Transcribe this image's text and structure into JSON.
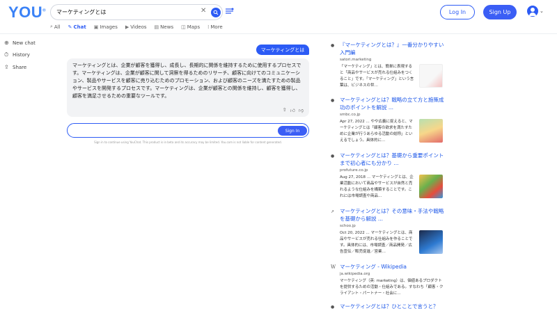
{
  "header": {
    "logo": "YOU",
    "logo_mark": "®",
    "search_query": "マーケティングとは",
    "login_label": "Log In",
    "signup_label": "Sign Up"
  },
  "tabs": [
    {
      "label": "All",
      "icon": "search-icon"
    },
    {
      "label": "Chat",
      "icon": "chat-icon",
      "active": true
    },
    {
      "label": "Images",
      "icon": "image-icon"
    },
    {
      "label": "Videos",
      "icon": "play-icon"
    },
    {
      "label": "News",
      "icon": "news-icon"
    },
    {
      "label": "Maps",
      "icon": "map-icon"
    },
    {
      "label": "More",
      "icon": "grid-icon"
    }
  ],
  "sidebar": {
    "items": [
      {
        "label": "New chat",
        "icon": "plus-icon"
      },
      {
        "label": "History",
        "icon": "history-icon"
      },
      {
        "label": "Share",
        "icon": "share-icon"
      }
    ]
  },
  "chat": {
    "user_message": "マーケティングとは",
    "answer": "マーケティングとは、企業が顧客を獲得し、成長し、長期的に関係を維持するために使用するプロセスです。マーケティングは、企業が顧客に関して洞察を得るためのリサーチ、顧客に向けてのコミュニケーション、製品やサービスを顧客に売り込むためのプロモーション、および顧客のニーズを満たすための製品やサービスを開発するプロセスです。マーケティングは、企業が顧客との関係を維持し、顧客を獲得し、顧客を満足させるための重要なツールです。",
    "input_placeholder": "",
    "signin_label": "Sign In",
    "disclaimer": "Sign in to continue using YouChat. This product is in beta and its accuracy may be limited. You.com is not liable for content generated."
  },
  "results": [
    {
      "title": "『マーケティングとは？』一番分かりやすい入門編",
      "source": "satori.marketing",
      "snippet": "「マーケティング」とは、簡単に表現すると「商品やサービスが売れる仕組みをつくること」です。「マーケティング」という言葉は、ビジネスの世…",
      "thumb": "t1",
      "bullet": "●"
    },
    {
      "title": "マーケティングとは？戦略の立て方と施策成功のポイントを解説 ...",
      "source": "smbc.co.jp",
      "snippet": "Apr 27, 2022 ... やや広義に捉えると、マーケティングとは「顧客の欲求を満たすために企業が行うあらゆる活動の総称」といえるでしょう。具体的に…",
      "thumb": "t2",
      "bullet": "●"
    },
    {
      "title": "マーケティングとは？基礎から重要ポイントまで初心者にも分かり ...",
      "source": "profuture.co.jp",
      "snippet": "Aug 27, 2018 ... マーケティングとは、企業活動において商品やサービスが自然と売れるような仕組みを構築することです。これには市場調査や商品…",
      "thumb": "t3",
      "bullet": "●"
    },
    {
      "title": "マーケティングとは？その意味・手法や戦略を基礎から解説 ...",
      "source": "schoo.jp",
      "snippet": "Oct 20, 2022 ... マーケティングとは、商品やサービスが売れる仕組みを作ることです。具体的には、市場調査／商品開発／広告宣伝／販売促進／営業…",
      "thumb": "t4",
      "bullet": "↗"
    },
    {
      "title": "マーケティング - Wikipedia",
      "source": "ja.wikipedia.org",
      "snippet": "マーケティング（英: marketing）は、価値あるプロダクトを提供するための活動・仕組みである。すなわち「顧客・クライアント・パートナー・社会に…",
      "thumb": "",
      "bullet": "W"
    },
    {
      "title": "マーケティングとは？ひとことで言うと？",
      "source": "",
      "snippet": "",
      "thumb": "",
      "bullet": "●"
    }
  ],
  "colors": {
    "brand": "#3b82f6",
    "accent": "#2c5bf5",
    "link": "#1a55e8"
  }
}
